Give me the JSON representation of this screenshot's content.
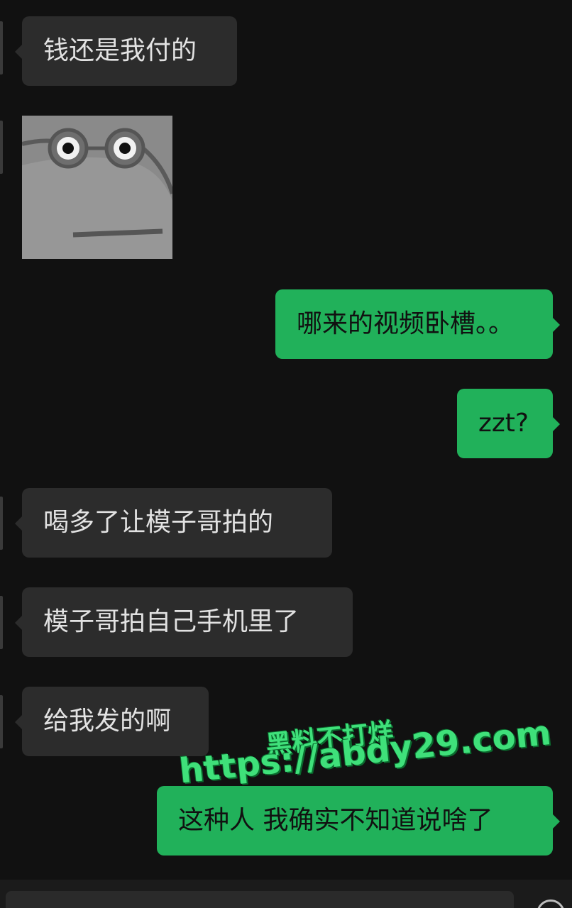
{
  "messages": [
    {
      "side": "in",
      "text": "钱还是我付的"
    },
    {
      "side": "in",
      "type": "sticker",
      "sticker_icon": "frog-glasses-sticker"
    },
    {
      "side": "out",
      "text": "哪来的视频卧槽。。"
    },
    {
      "side": "out",
      "text": "zzt?"
    },
    {
      "side": "in",
      "text": "喝多了让模子哥拍的"
    },
    {
      "side": "in",
      "text": "模子哥拍自己手机里了"
    },
    {
      "side": "in",
      "text": "给我发的啊"
    },
    {
      "side": "out",
      "text": "这种人 我确实不知道说啥了"
    }
  ],
  "watermark": {
    "line1": "黑料不打烊",
    "line2": "https://abdy29.com"
  },
  "colors": {
    "background": "#111111",
    "incoming_bubble": "#2c2c2c",
    "outgoing_bubble": "#21b15a",
    "watermark": "#3fe07a"
  }
}
